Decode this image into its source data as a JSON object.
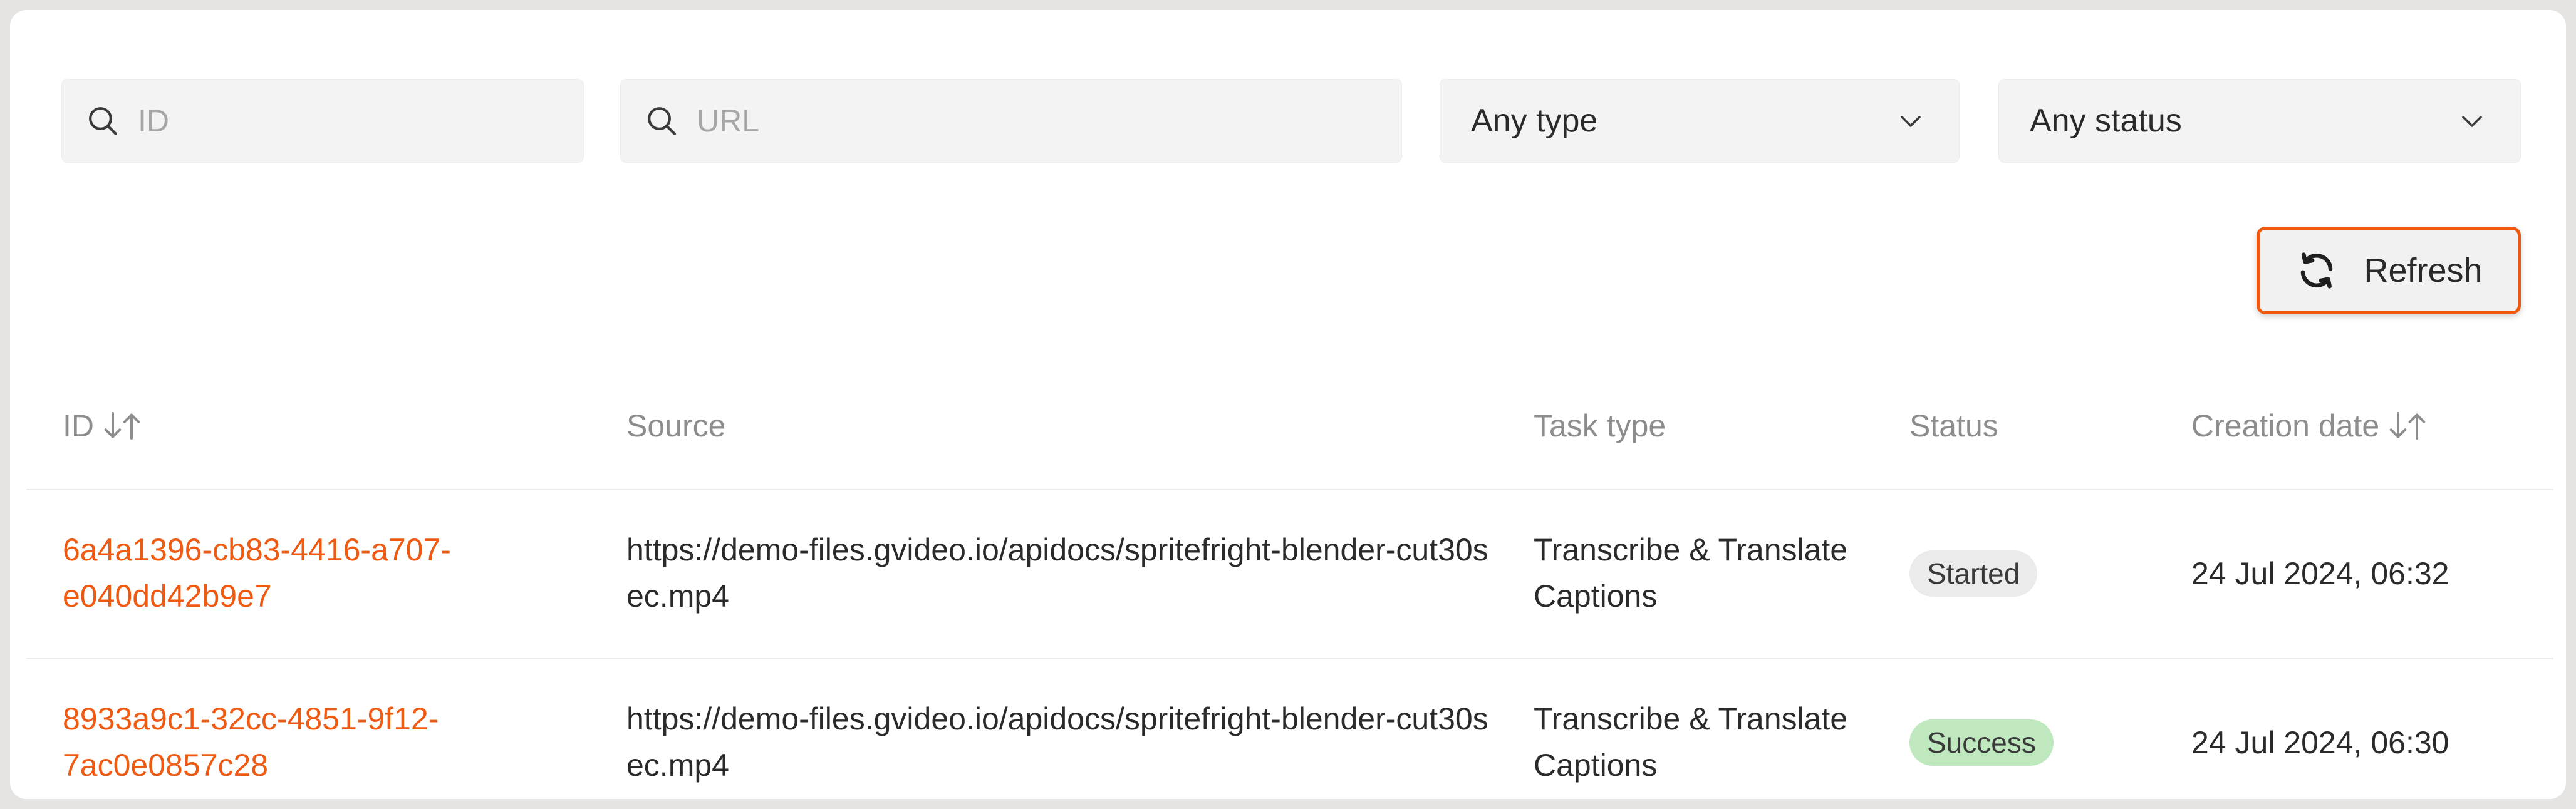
{
  "filters": {
    "id_search": {
      "placeholder": "ID",
      "value": ""
    },
    "url_search": {
      "placeholder": "URL",
      "value": ""
    },
    "type_select": {
      "value": "Any type"
    },
    "status_select": {
      "value": "Any status"
    }
  },
  "toolbar": {
    "refresh_label": "Refresh"
  },
  "table": {
    "headers": {
      "id": "ID",
      "source": "Source",
      "task_type": "Task type",
      "status": "Status",
      "creation_date": "Creation date"
    },
    "rows": [
      {
        "id": "6a4a1396-cb83-4416-a707-e040dd42b9e7",
        "source": "https://demo-files.gvideo.io/apidocs/spritefright-blender-cut30sec.mp4",
        "task_type": "Transcribe & Translate Captions",
        "status": "Started",
        "creation_date": "24 Jul 2024, 06:32"
      },
      {
        "id": "8933a9c1-32cc-4851-9f12-7ac0e0857c28",
        "source": "https://demo-files.gvideo.io/apidocs/spritefright-blender-cut30sec.mp4",
        "task_type": "Transcribe & Translate Captions",
        "status": "Success",
        "creation_date": "24 Jul 2024, 06:30"
      }
    ]
  },
  "colors": {
    "accent": "#ef5a12",
    "success_badge": "#bfe8bf",
    "started_badge": "#ebebeb"
  },
  "icons": {
    "search": "search-icon",
    "chevron": "chevron-down-icon",
    "refresh": "refresh-icon",
    "sort": "sort-icon"
  }
}
